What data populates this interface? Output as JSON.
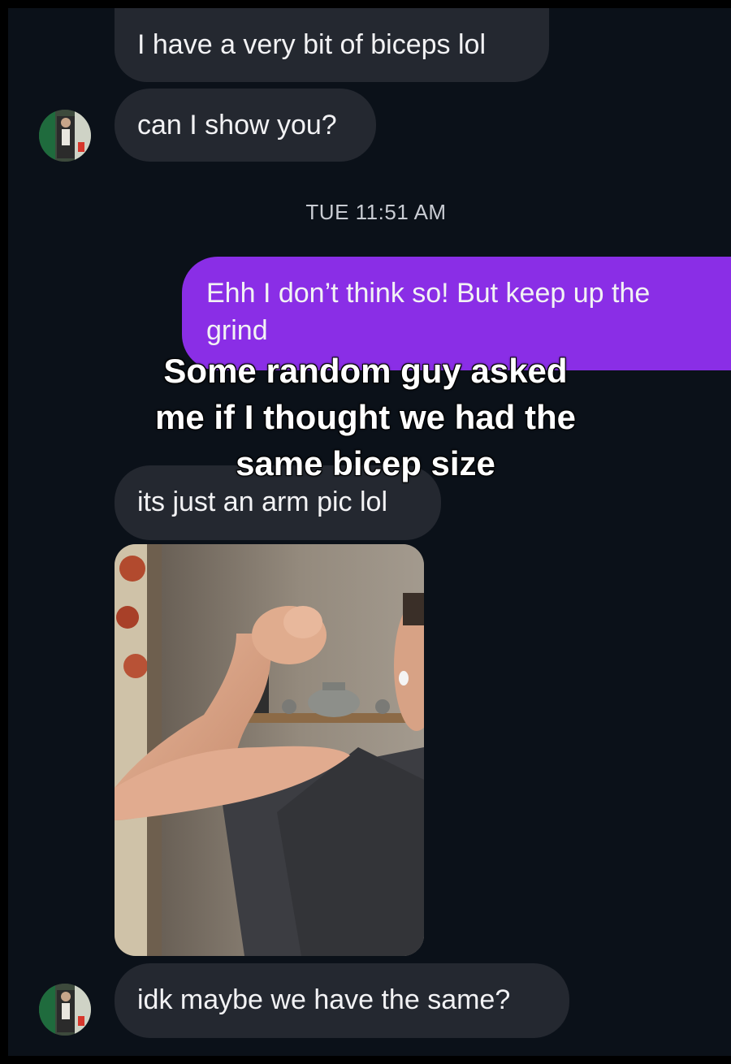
{
  "conversation": {
    "messages": [
      {
        "side": "incoming",
        "text": "I have a very bit of biceps lol"
      },
      {
        "side": "incoming",
        "text": "can I show you?"
      },
      {
        "side": "outgoing",
        "text": "Ehh I don’t think so! But keep up the grind"
      },
      {
        "side": "incoming",
        "text": "its just an arm pic lol"
      },
      {
        "side": "incoming",
        "text": "idk maybe we have the same?"
      }
    ],
    "timestamp": "TUE 11:51 AM"
  },
  "overlay": {
    "caption_lines": [
      "Some random guy asked",
      "me if I thought we had the",
      "same bicep size"
    ]
  },
  "colors": {
    "background": "#0b1119",
    "incoming_bubble": "#242830",
    "outgoing_bubble": "#8a2ee6",
    "text": "#f2f2f4"
  },
  "icons": {
    "avatar": "profile-photo-avatar",
    "attachment": "arm-flex-photo"
  }
}
